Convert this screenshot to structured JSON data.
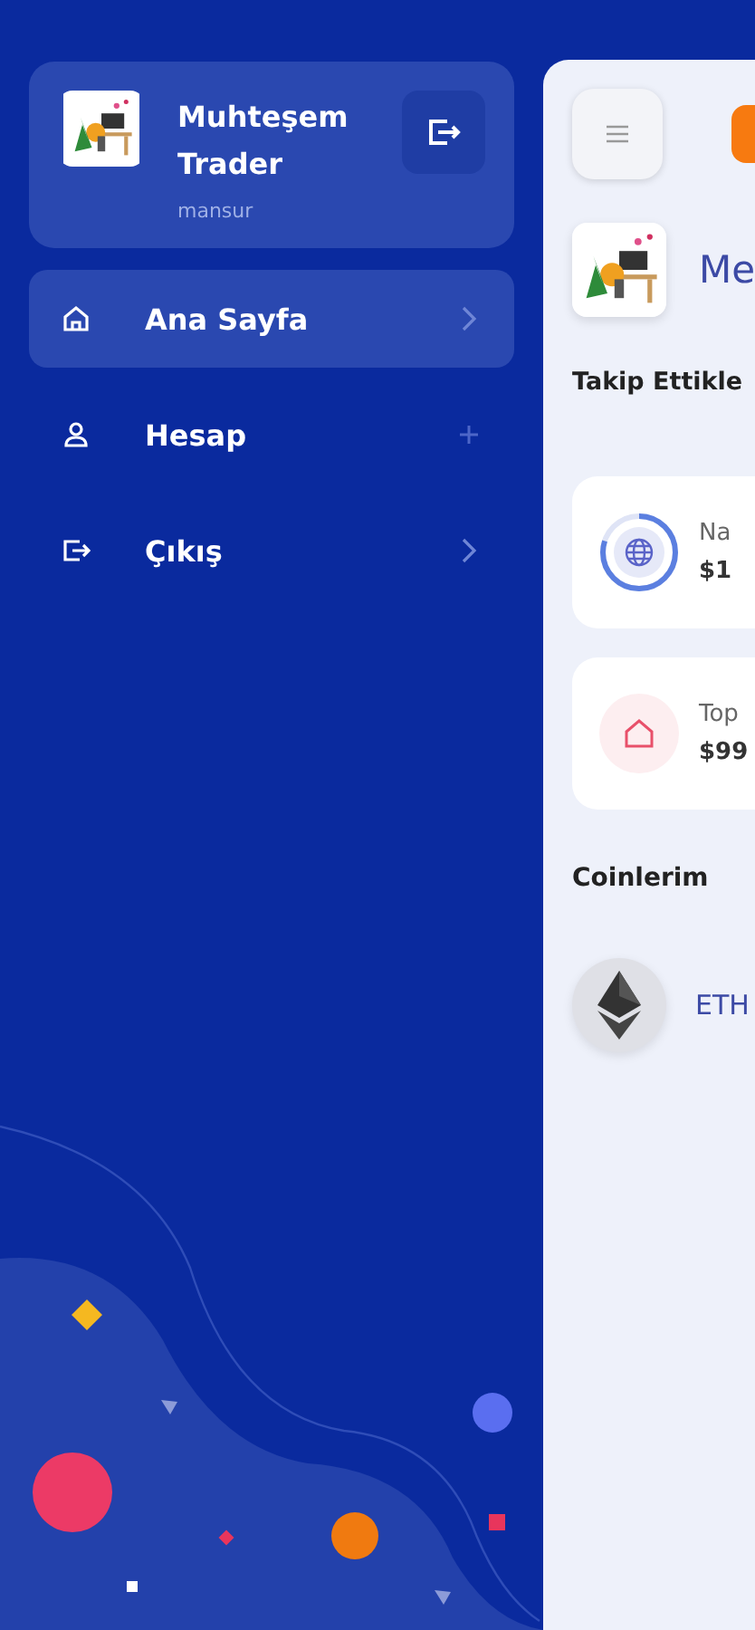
{
  "profile": {
    "name": "Muhteşem Trader",
    "username": "mansur"
  },
  "nav": [
    {
      "label": "Ana Sayfa",
      "selected": true,
      "kind": "chevron"
    },
    {
      "label": "Hesap",
      "selected": false,
      "kind": "plus"
    },
    {
      "label": "Çıkış",
      "selected": false,
      "kind": "chevron"
    }
  ],
  "main": {
    "header_title": "Me",
    "section_title": "Takip Ettikle",
    "stats": [
      {
        "label": "Na",
        "value": "$1",
        "kind": "globe",
        "level": 0.8
      },
      {
        "label": "Top",
        "value": "$99",
        "kind": "home"
      }
    ],
    "coins_title": "Coinlerim",
    "coins": [
      {
        "symbol": "ETH"
      }
    ]
  }
}
